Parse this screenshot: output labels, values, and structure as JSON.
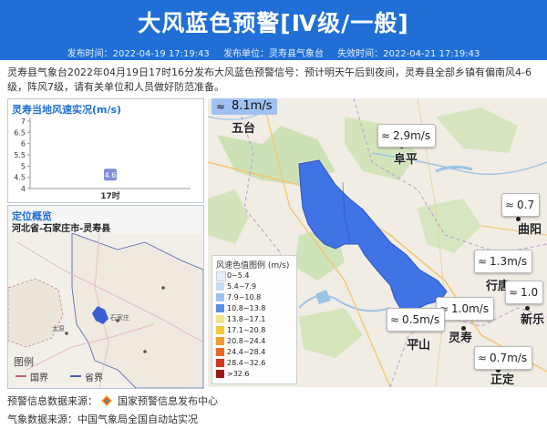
{
  "header": {
    "title": "大风蓝色预警[Ⅳ级/一般]",
    "publish_time": "发布时间：2022-04-19 17:19:43",
    "publisher": "发布单位：灵寿县气象台",
    "expire_time": "失效时间：2022-04-21 17:19:43"
  },
  "description": "灵寿县气象台2022年04月19日17时16分发布大风蓝色预警信号：预计明天午后到夜间，灵寿县全部乡镇有偏南风4-6级，阵风7级，请有关单位和人员做好防范准备。",
  "wind_panel": {
    "title": "灵寿当地风速实况(m/s)"
  },
  "chart_data": {
    "type": "bar",
    "title": "灵寿当地风速实况(m/s)",
    "categories": [
      "17时"
    ],
    "values": [
      4.6
    ],
    "yticks": [
      4,
      4.5,
      5,
      5.5,
      6,
      6.5,
      7
    ],
    "ylim": [
      4,
      7
    ],
    "bar_color": "#7f8fd8"
  },
  "location": {
    "title": "定位概览",
    "path": "河北省-石家庄市-灵寿县",
    "map_labels": {
      "taiyuan": "太原",
      "shijiazhuang": "石家庄"
    },
    "legend": {
      "title": "图例",
      "items": [
        {
          "label": "国界",
          "color": "#c0607a"
        },
        {
          "label": "省界",
          "color": "#4a5fb0"
        }
      ]
    }
  },
  "main_map": {
    "cities": {
      "wutai": "五台",
      "fuping": "阜平",
      "quyang": "曲阳",
      "xingtang": "行唐",
      "pingshan": "平山",
      "lingshou": "灵寿",
      "zhengding": "正定",
      "xinle": "新乐"
    },
    "wind_labels": {
      "top": "8.1m/s",
      "fuping": "2.9m/s",
      "quyang": "0.7",
      "mid_right": "1.3m/s",
      "right2": "1.0",
      "lingshou": "1.0m/s",
      "pingshan": "0.5m/s",
      "zhengding": "0.7m/s"
    },
    "legend": {
      "title": "风速色值图例 (m/s)",
      "items": [
        {
          "label": "0~5.4",
          "color": "#e6eef8"
        },
        {
          "label": "5.4~7.9",
          "color": "#c5dbf5"
        },
        {
          "label": "7.9~10.8",
          "color": "#9fc1f2"
        },
        {
          "label": "10.8~13.8",
          "color": "#5b8ee8"
        },
        {
          "label": "13.8~17.1",
          "color": "#f2e58a"
        },
        {
          "label": "17.1~20.8",
          "color": "#f4c63c"
        },
        {
          "label": "20.8~24.4",
          "color": "#f29a2e"
        },
        {
          "label": "24.4~28.4",
          "color": "#ee6a24"
        },
        {
          "label": "28.4~32.6",
          "color": "#d63520"
        },
        {
          "label": ">32.6",
          "color": "#9e1818"
        }
      ]
    }
  },
  "footer": {
    "warning_source": "预警信息数据来源：",
    "warning_source_name": "国家预警信息发布中心",
    "weather_source": "气象数据来源：中国气象局全国自动站实况"
  }
}
